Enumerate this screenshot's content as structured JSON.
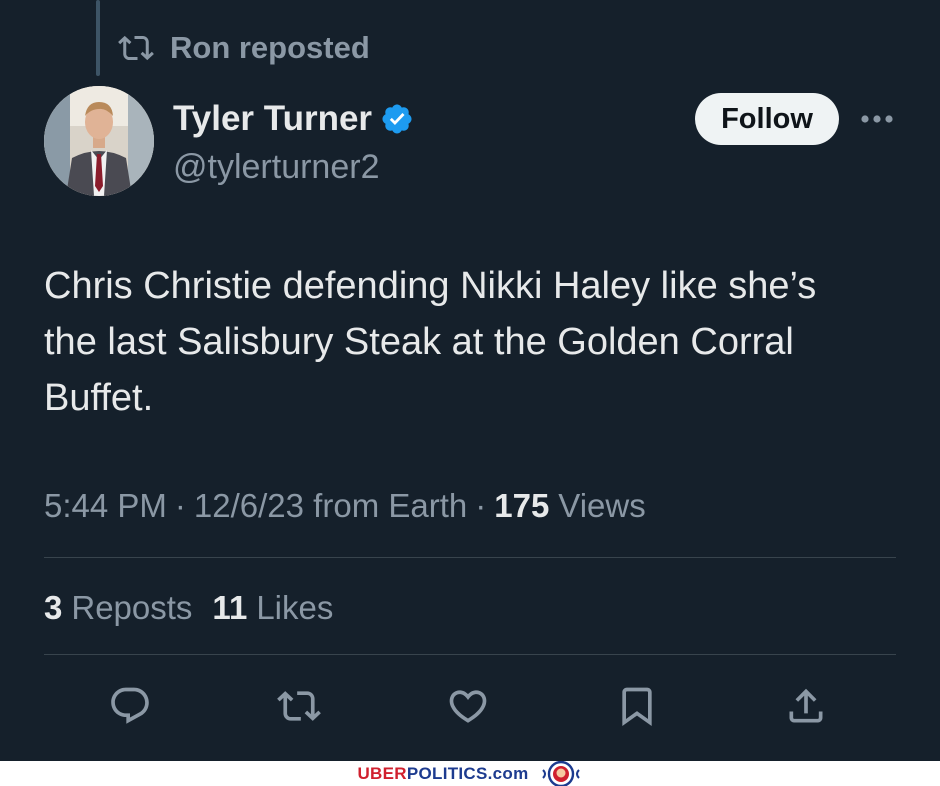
{
  "repost": {
    "label": "Ron reposted",
    "icon": "repost-icon"
  },
  "author": {
    "name": "Tyler Turner",
    "handle": "@tylerturner2",
    "verified_icon": "verified-badge-icon",
    "verified_color": "#1d9bf0"
  },
  "header": {
    "follow_label": "Follow",
    "more_icon": "more-options-icon"
  },
  "tweet": {
    "text": "Chris Christie defending Nikki Haley like she’s\nthe last Salisbury Steak at the Golden Corral\nBuffet."
  },
  "meta": {
    "time": "5:44 PM",
    "separator": "·",
    "date_source": "12/6/23 from Earth",
    "views_count": "175",
    "views_label": "Views"
  },
  "stats": {
    "reposts_count": "3",
    "reposts_label": "Reposts",
    "likes_count": "11",
    "likes_label": "Likes"
  },
  "actions": [
    {
      "icon": "reply-icon"
    },
    {
      "icon": "repost-icon"
    },
    {
      "icon": "like-icon"
    },
    {
      "icon": "bookmark-icon"
    },
    {
      "icon": "share-icon"
    }
  ],
  "footer": {
    "brand_red": "UBER",
    "brand_blue": "POLITICS",
    "brand_suffix": ".com",
    "logo_icon": "lion-crest-icon"
  },
  "colors": {
    "background": "#15202b",
    "text_primary": "#e7e9ea",
    "text_secondary": "#8b98a5",
    "divider": "#38444d",
    "brand_red": "#d0202e",
    "brand_blue": "#1d3b8f"
  }
}
